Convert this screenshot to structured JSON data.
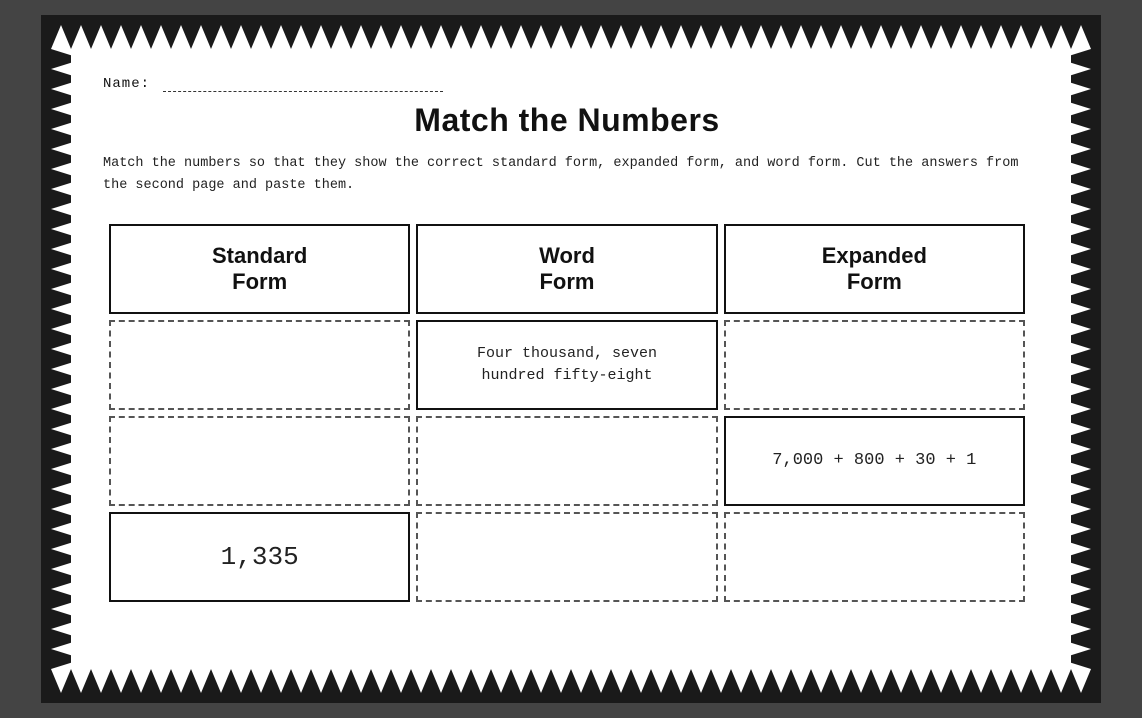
{
  "page": {
    "name_label": "Name:",
    "title": "Match the Numbers",
    "instructions": "Match the numbers so that they show the correct standard form, expanded form, and word form. Cut the answers from the second page and paste them.",
    "table": {
      "headers": [
        {
          "id": "standard-form-header",
          "line1": "Standard",
          "line2": "Form"
        },
        {
          "id": "word-form-header",
          "line1": "Word",
          "line2": "Form"
        },
        {
          "id": "expanded-form-header",
          "line1": "Expanded",
          "line2": "Form"
        }
      ],
      "rows": [
        {
          "cells": [
            {
              "type": "dashed",
              "content": ""
            },
            {
              "type": "solid",
              "content": "Four thousand, seven\nhundred fifty-eight"
            },
            {
              "type": "dashed",
              "content": ""
            }
          ]
        },
        {
          "cells": [
            {
              "type": "dashed",
              "content": ""
            },
            {
              "type": "dashed",
              "content": ""
            },
            {
              "type": "solid",
              "content": "7,000 + 800 + 30 + 1"
            }
          ]
        },
        {
          "cells": [
            {
              "type": "solid",
              "content": "1,335",
              "large": true
            },
            {
              "type": "dashed",
              "content": ""
            },
            {
              "type": "dashed",
              "content": ""
            }
          ]
        }
      ]
    }
  }
}
